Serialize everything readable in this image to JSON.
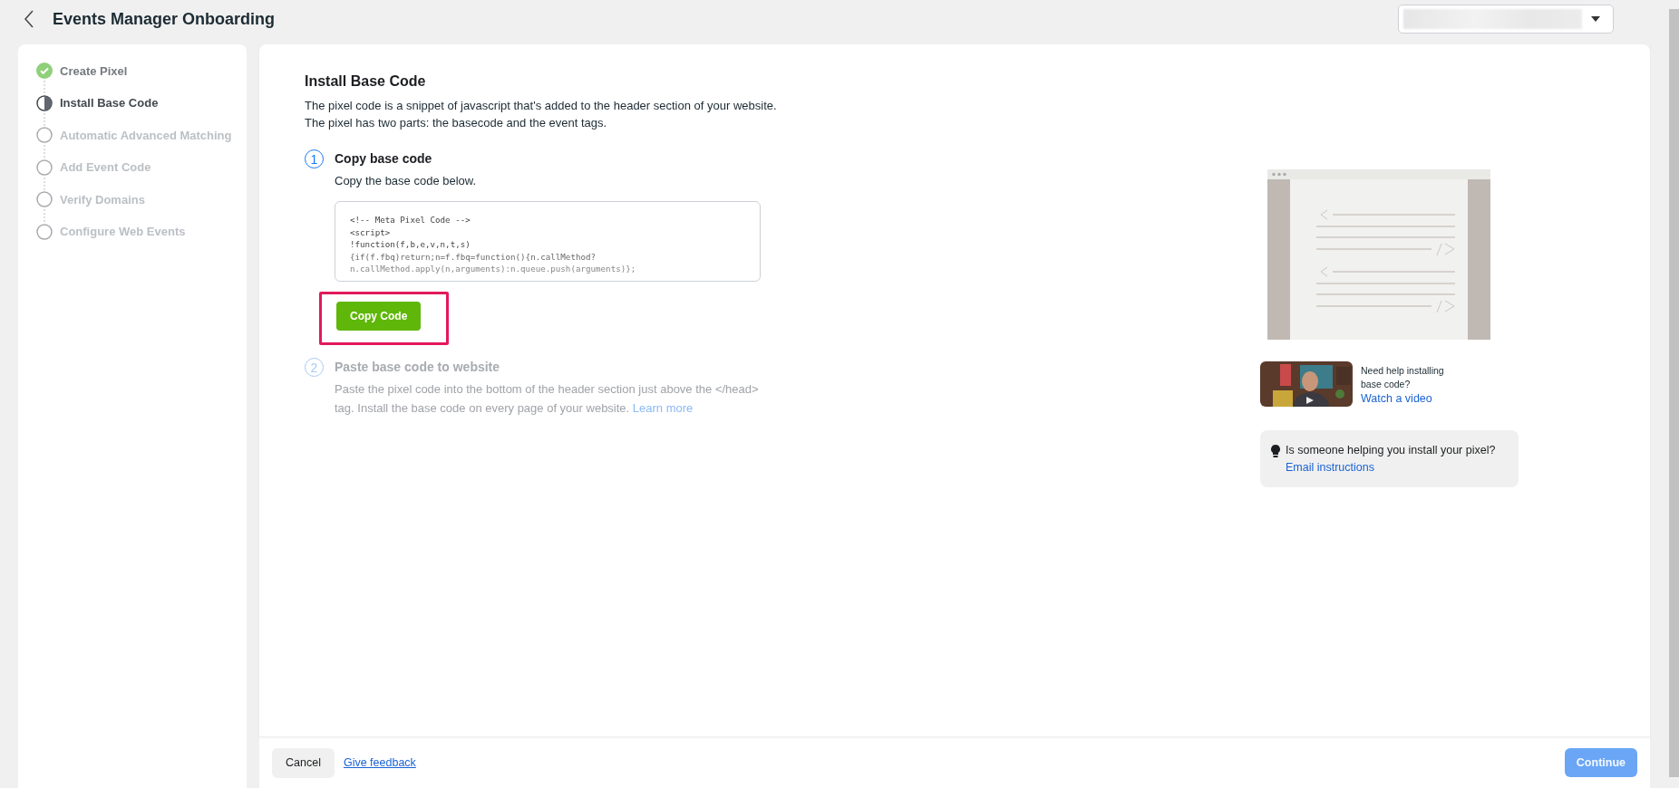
{
  "header": {
    "title": "Events Manager Onboarding",
    "account_dropdown": {
      "redacted": true
    }
  },
  "steps": [
    {
      "label": "Create Pixel",
      "completed": true,
      "selected": false
    },
    {
      "label": "Install Base Code",
      "completed": false,
      "selected": true
    },
    {
      "label": "Automatic Advanced Matching",
      "completed": false,
      "selected": false
    },
    {
      "label": "Add Event Code",
      "completed": false,
      "selected": false
    },
    {
      "label": "Verify Domains",
      "completed": false,
      "selected": false
    },
    {
      "label": "Configure Web Events",
      "completed": false,
      "selected": false
    }
  ],
  "main": {
    "title": "Install Base Code",
    "description": [
      "The pixel code is a snippet of javascript that's added to the header section of your website.",
      "The pixel has two parts: the basecode and the event tags."
    ],
    "instructions": [
      {
        "number": "1",
        "title": "Copy base code",
        "disabled": false,
        "text": "Copy the base code below.",
        "code_lines": [
          "<!-- Meta Pixel Code -->",
          "<script>",
          "!function(f,b,e,v,n,t,s)",
          "{if(f.fbq)return;n=f.fbq=function(){n.callMethod?",
          "n.callMethod.apply(n,arguments):n.queue.push(arguments)};"
        ],
        "button": {
          "label": "Copy Code",
          "highlighted": true
        }
      },
      {
        "number": "2",
        "title": "Paste base code to website",
        "disabled": true,
        "text": "Paste the pixel code into the bottom of the header section just above the </head> tag. Install the base code on every page of your website.",
        "link": "Learn more"
      }
    ]
  },
  "help": {
    "video": {
      "text": "Need help installing base code?",
      "link": "Watch a video"
    },
    "tip": {
      "text": "Is someone helping you install your pixel?",
      "link": "Email instructions"
    }
  },
  "footer": {
    "cancel": "Cancel",
    "feedback": "Give feedback",
    "continue": {
      "label": "Continue",
      "disabled": true
    }
  }
}
